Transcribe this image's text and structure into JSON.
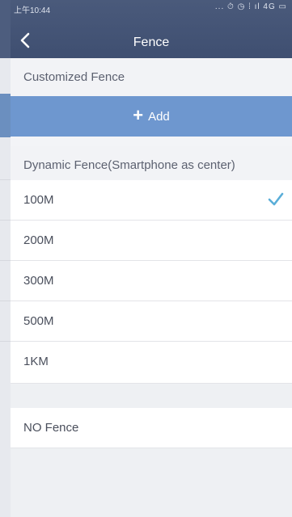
{
  "status_bar": {
    "time": "上午10:44",
    "icons": "... ⏱ ◷ ⁞ ıl 4G ▭"
  },
  "header": {
    "back_icon": "back-arrow",
    "title": "Fence"
  },
  "customized": {
    "label": "Customized Fence",
    "add_button": "Add"
  },
  "dynamic": {
    "label": "Dynamic Fence(Smartphone as center)",
    "options": [
      {
        "label": "100M",
        "selected": true
      },
      {
        "label": "200M",
        "selected": false
      },
      {
        "label": "300M",
        "selected": false
      },
      {
        "label": "500M",
        "selected": false
      },
      {
        "label": "1KM",
        "selected": false
      }
    ]
  },
  "no_fence": {
    "label": "NO Fence"
  },
  "colors": {
    "header": "#4a5a7b",
    "add_button": "#6e97cf",
    "check": "#5aaed8"
  }
}
